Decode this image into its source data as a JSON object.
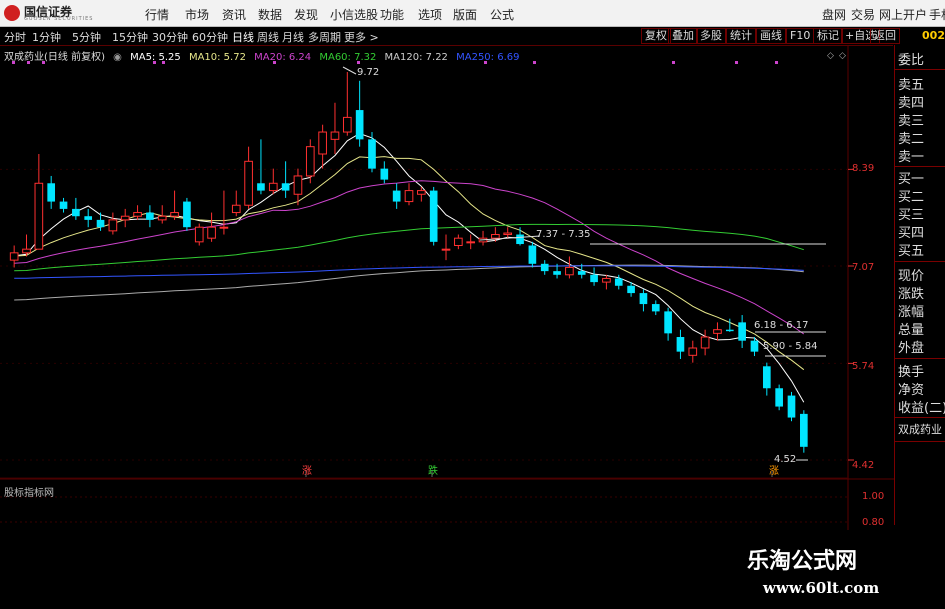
{
  "top_menu": {
    "logo_name": "国信证券",
    "logo_sub": "GUOSEN SECURITIES",
    "items": [
      "行情",
      "市场",
      "资讯",
      "数据",
      "发现",
      "小信选股",
      "功能",
      "选项",
      "版面",
      "公式"
    ],
    "right_items": [
      "盘网",
      "交易",
      "网上开户",
      "手机"
    ]
  },
  "periods": [
    "分时",
    "1分钟",
    "5分钟",
    "15分钟",
    "30分钟",
    "60分钟",
    "日线",
    "周线",
    "月线",
    "多周期",
    "更多 >"
  ],
  "active_period": "日线",
  "tools": [
    "复权",
    "叠加",
    "多股",
    "统计",
    "画线",
    "F10",
    "标记",
    "+自选",
    "返回"
  ],
  "stock_code": "002",
  "legend": {
    "title": "双成药业(日线 前复权)",
    "ma5": "MA5: 5.25",
    "ma10": "MA10: 5.72",
    "ma20": "MA20: 6.24",
    "ma60": "MA60: 7.32",
    "ma120": "MA120: 7.22",
    "ma250": "MA250: 6.69"
  },
  "colors": {
    "up": "#ff3030",
    "down": "#00e5ff",
    "ma5": "#ffffff",
    "ma10": "#e6e68a",
    "ma20": "#cc44cc",
    "ma60": "#33cc33",
    "ma120": "#aaaaaa",
    "ma250": "#3355ff",
    "grid": "#5a0000"
  },
  "right_panel": [
    "委比",
    "卖五",
    "卖四",
    "卖三",
    "卖二",
    "卖一",
    "买一",
    "买二",
    "买三",
    "买四",
    "买五",
    "现价",
    "涨跌",
    "涨幅",
    "总量",
    "外盘",
    "换手",
    "净资",
    "收益(二)",
    "双成药业"
  ],
  "price_axis": [
    "8.39",
    "7.07",
    "5.74",
    "4.42"
  ],
  "sub_axis": [
    "1.00",
    "0.80"
  ],
  "annotations": {
    "high": "9.72",
    "low": "4.52",
    "range1": "7.37 - 7.35",
    "range2": "6.18 - 6.17",
    "range3": "5.90 - 5.84",
    "signal_up1": "涨",
    "signal_down": "跌",
    "signal_up2": "涨"
  },
  "sub_panel_title": "股标指标网",
  "watermark": {
    "name": "乐淘公式网",
    "url": "www.60lt.com"
  },
  "chart_data": {
    "type": "candlestick",
    "y_axis_ticks": [
      8.39,
      7.07,
      5.74,
      4.42
    ],
    "ylim": [
      4.42,
      9.72
    ],
    "candles": [
      {
        "o": 7.15,
        "h": 7.35,
        "c": 7.25,
        "l": 7.05
      },
      {
        "o": 7.25,
        "h": 7.5,
        "c": 7.3,
        "l": 7.2
      },
      {
        "o": 7.3,
        "h": 8.6,
        "c": 8.2,
        "l": 7.3
      },
      {
        "o": 8.2,
        "h": 8.3,
        "c": 7.95,
        "l": 7.85
      },
      {
        "o": 7.95,
        "h": 8.0,
        "c": 7.85,
        "l": 7.8
      },
      {
        "o": 7.85,
        "h": 8.0,
        "c": 7.75,
        "l": 7.7
      },
      {
        "o": 7.75,
        "h": 7.85,
        "c": 7.7,
        "l": 7.6
      },
      {
        "o": 7.7,
        "h": 7.8,
        "c": 7.6,
        "l": 7.55
      },
      {
        "o": 7.55,
        "h": 7.8,
        "c": 7.7,
        "l": 7.5
      },
      {
        "o": 7.7,
        "h": 7.85,
        "c": 7.75,
        "l": 7.6
      },
      {
        "o": 7.75,
        "h": 7.9,
        "c": 7.8,
        "l": 7.7
      },
      {
        "o": 7.8,
        "h": 7.9,
        "c": 7.7,
        "l": 7.6
      },
      {
        "o": 7.7,
        "h": 7.9,
        "c": 7.75,
        "l": 7.65
      },
      {
        "o": 7.75,
        "h": 8.1,
        "c": 7.8,
        "l": 7.7
      },
      {
        "o": 7.95,
        "h": 8.0,
        "c": 7.6,
        "l": 7.55
      },
      {
        "o": 7.4,
        "h": 7.65,
        "c": 7.6,
        "l": 7.35
      },
      {
        "o": 7.45,
        "h": 7.8,
        "c": 7.6,
        "l": 7.4
      },
      {
        "o": 7.6,
        "h": 8.1,
        "c": 7.6,
        "l": 7.5
      },
      {
        "o": 7.8,
        "h": 8.1,
        "c": 7.9,
        "l": 7.75
      },
      {
        "o": 7.9,
        "h": 8.7,
        "c": 8.5,
        "l": 7.85
      },
      {
        "o": 8.2,
        "h": 8.8,
        "c": 8.1,
        "l": 8.05
      },
      {
        "o": 8.1,
        "h": 8.4,
        "c": 8.2,
        "l": 8.05
      },
      {
        "o": 8.2,
        "h": 8.5,
        "c": 8.1,
        "l": 8.0
      },
      {
        "o": 8.05,
        "h": 8.4,
        "c": 8.3,
        "l": 7.9
      },
      {
        "o": 8.3,
        "h": 8.8,
        "c": 8.7,
        "l": 8.2
      },
      {
        "o": 8.6,
        "h": 9.0,
        "c": 8.9,
        "l": 8.4
      },
      {
        "o": 8.8,
        "h": 9.3,
        "c": 8.9,
        "l": 8.6
      },
      {
        "o": 8.9,
        "h": 9.72,
        "c": 9.1,
        "l": 8.85
      },
      {
        "o": 9.2,
        "h": 9.6,
        "c": 8.8,
        "l": 8.7
      },
      {
        "o": 8.8,
        "h": 8.9,
        "c": 8.4,
        "l": 8.35
      },
      {
        "o": 8.4,
        "h": 8.5,
        "c": 8.25,
        "l": 8.2
      },
      {
        "o": 8.1,
        "h": 8.2,
        "c": 7.95,
        "l": 7.85
      },
      {
        "o": 7.95,
        "h": 8.2,
        "c": 8.1,
        "l": 7.9
      },
      {
        "o": 8.05,
        "h": 8.15,
        "c": 8.1,
        "l": 7.95
      },
      {
        "o": 8.1,
        "h": 8.15,
        "c": 7.4,
        "l": 7.35
      },
      {
        "o": 7.3,
        "h": 7.5,
        "c": 7.3,
        "l": 7.15
      },
      {
        "o": 7.35,
        "h": 7.5,
        "c": 7.45,
        "l": 7.3
      },
      {
        "o": 7.4,
        "h": 7.5,
        "c": 7.4,
        "l": 7.3
      },
      {
        "o": 7.4,
        "h": 7.55,
        "c": 7.45,
        "l": 7.35
      },
      {
        "o": 7.45,
        "h": 7.6,
        "c": 7.5,
        "l": 7.4
      },
      {
        "o": 7.5,
        "h": 7.6,
        "c": 7.52,
        "l": 7.45
      },
      {
        "o": 7.5,
        "h": 7.6,
        "c": 7.37,
        "l": 7.35
      },
      {
        "o": 7.35,
        "h": 7.4,
        "c": 7.1,
        "l": 7.05
      },
      {
        "o": 7.1,
        "h": 7.15,
        "c": 7.0,
        "l": 6.95
      },
      {
        "o": 7.0,
        "h": 7.1,
        "c": 6.95,
        "l": 6.9
      },
      {
        "o": 6.95,
        "h": 7.2,
        "c": 7.05,
        "l": 6.9
      },
      {
        "o": 7.0,
        "h": 7.1,
        "c": 6.95,
        "l": 6.9
      },
      {
        "o": 6.95,
        "h": 7.05,
        "c": 6.85,
        "l": 6.8
      },
      {
        "o": 6.85,
        "h": 6.95,
        "c": 6.9,
        "l": 6.75
      },
      {
        "o": 6.9,
        "h": 6.95,
        "c": 6.8,
        "l": 6.75
      },
      {
        "o": 6.8,
        "h": 6.85,
        "c": 6.7,
        "l": 6.65
      },
      {
        "o": 6.7,
        "h": 6.75,
        "c": 6.55,
        "l": 6.45
      },
      {
        "o": 6.55,
        "h": 6.6,
        "c": 6.45,
        "l": 6.4
      },
      {
        "o": 6.45,
        "h": 6.5,
        "c": 6.15,
        "l": 6.05
      },
      {
        "o": 6.1,
        "h": 6.2,
        "c": 5.9,
        "l": 5.8
      },
      {
        "o": 5.85,
        "h": 6.05,
        "c": 5.95,
        "l": 5.75
      },
      {
        "o": 5.95,
        "h": 6.2,
        "c": 6.1,
        "l": 5.85
      },
      {
        "o": 6.15,
        "h": 6.3,
        "c": 6.2,
        "l": 6.05
      },
      {
        "o": 6.2,
        "h": 6.35,
        "c": 6.18,
        "l": 6.17
      },
      {
        "o": 6.3,
        "h": 6.4,
        "c": 6.05,
        "l": 5.95
      },
      {
        "o": 6.05,
        "h": 6.1,
        "c": 5.9,
        "l": 5.84
      },
      {
        "o": 5.7,
        "h": 5.75,
        "c": 5.4,
        "l": 5.3
      },
      {
        "o": 5.4,
        "h": 5.45,
        "c": 5.15,
        "l": 5.1
      },
      {
        "o": 5.3,
        "h": 5.35,
        "c": 5.0,
        "l": 4.95
      },
      {
        "o": 5.05,
        "h": 5.1,
        "c": 4.6,
        "l": 4.52
      }
    ],
    "ma_levels": {
      "MA5": 5.25,
      "MA10": 5.72,
      "MA20": 6.24,
      "MA60": 7.32,
      "MA120": 7.22,
      "MA250": 6.69
    }
  }
}
